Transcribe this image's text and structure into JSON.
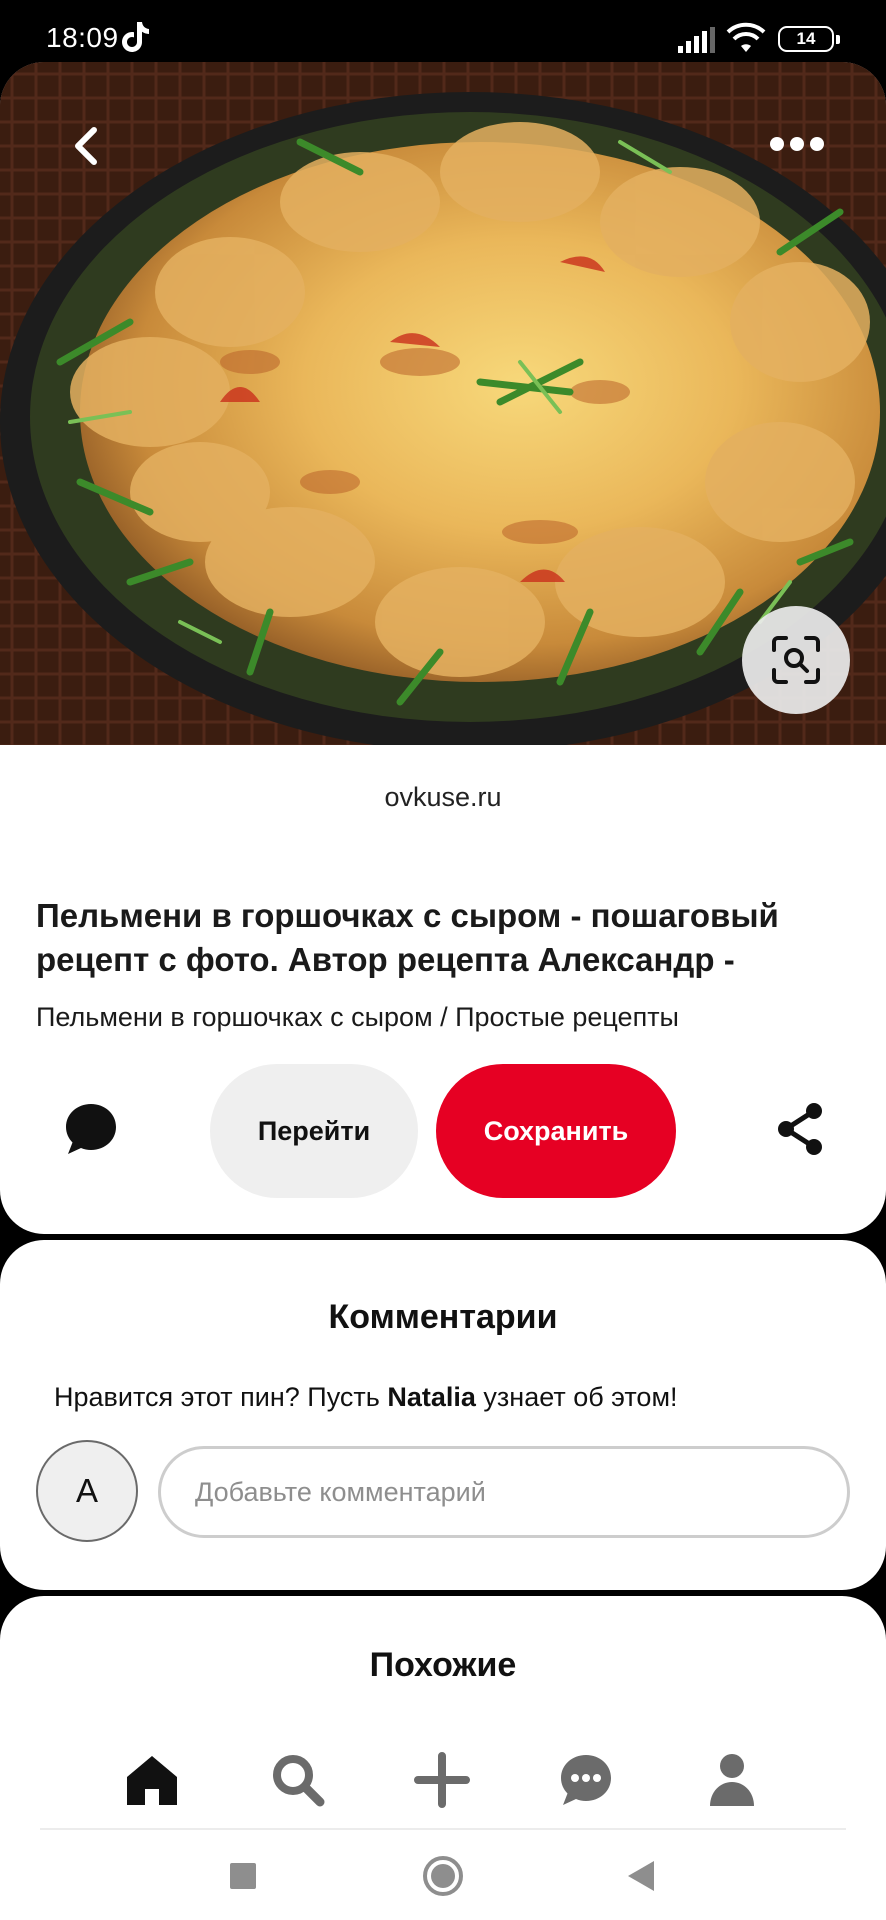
{
  "status_bar": {
    "time": "18:09",
    "battery": "14",
    "icons": [
      "tiktok-icon",
      "signal-icon",
      "wifi-icon",
      "battery-icon"
    ]
  },
  "pin": {
    "image_alt": "pelmeni-cheese-skillet-photo",
    "source": "ovkuse.ru",
    "title": "Пельмени в горшочках с сыром - пошаговый рецепт с фото. Автор рецепта Александр -",
    "subtitle": "Пельмени в горшочках с сыром / Простые рецепты",
    "visit_label": "Перейти",
    "save_label": "Сохранить",
    "icons": [
      "back-icon",
      "more-icon",
      "visual-search-icon",
      "comment-bubble-icon",
      "share-icon"
    ]
  },
  "comments": {
    "title": "Комментарии",
    "prompt_before": "Нравится этот пин? Пусть ",
    "prompt_name": "Natalia",
    "prompt_after": " узнает об этом!",
    "avatar_letter": "A",
    "input_placeholder": "Добавьте комментарий",
    "input_value": ""
  },
  "similar": {
    "title": "Похожие"
  },
  "bottom_nav": {
    "items": [
      "home-icon",
      "search-icon",
      "create-icon",
      "messages-icon",
      "profile-icon"
    ],
    "active": "home-icon"
  },
  "system_nav": {
    "items": [
      "recents-icon",
      "home-circle-icon",
      "back-triangle-icon"
    ]
  },
  "colors": {
    "accent": "#e60023",
    "visit_bg": "#efefef",
    "background": "#000000",
    "card": "#ffffff"
  }
}
